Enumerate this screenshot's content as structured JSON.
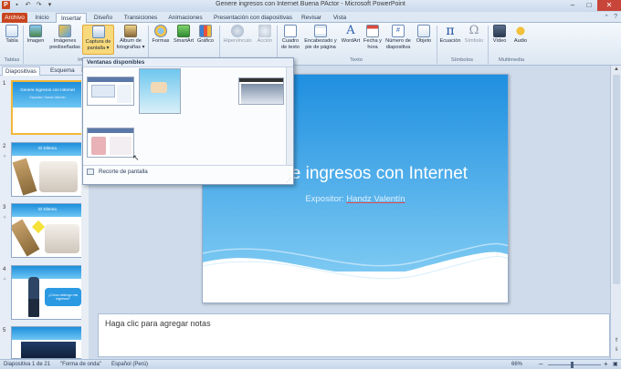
{
  "window": {
    "title": "Genere ingresos con Internet Buena PActor - Microsoft PowerPoint",
    "controls": [
      "–",
      "□",
      "✕"
    ]
  },
  "tabs": [
    "Archivo",
    "Inicio",
    "Insertar",
    "Diseño",
    "Transiciones",
    "Animaciones",
    "Presentación con diapositivas",
    "Revisar",
    "Vista"
  ],
  "ribbon": {
    "buttons": {
      "tabla": "Tabla",
      "imagen": "Imagen",
      "imagenes": "Imágenes prediseñadas",
      "captura": "Captura de pantalla ▾",
      "album": "Álbum de fotografías ▾",
      "formas": "Formas",
      "smartart": "SmartArt",
      "grafico": "Gráfico",
      "hipervinculo": "Hipervínculo",
      "accion": "Acción",
      "cuadro": "Cuadro de texto",
      "encabezado": "Encabezado y pie de página",
      "wordart": "WordArt",
      "fecha": "Fecha y hora",
      "numero": "Número de diapositiva",
      "objeto": "Objeto",
      "ecuacion": "Ecuación",
      "simbolo": "Símbolo",
      "video": "Vídeo",
      "audio": "Audio"
    },
    "groups": {
      "tablas": "Tablas",
      "imagenes": "Imá",
      "texto": "Texto",
      "simbolos": "Símbolos",
      "multimedia": "Multimedia"
    }
  },
  "leftpane": {
    "tabs": [
      "Diapositivas",
      "Esquema"
    ],
    "close": "✕",
    "slides": [
      {
        "num": "1",
        "title": "Genere ingresos con Internet",
        "sub": "Expositor: Handz Valentín"
      },
      {
        "num": "2",
        "title": "El Dilema",
        "sub": ""
      },
      {
        "num": "3",
        "title": "El Dilema",
        "sub": ""
      },
      {
        "num": "4",
        "title": "",
        "sub": "¿Cómo obtengo mis ingresos?"
      },
      {
        "num": "5",
        "title": "",
        "sub": ""
      }
    ]
  },
  "dropdown": {
    "header": "Ventanas disponibles",
    "item": "Recorte de pantalla"
  },
  "slide": {
    "title": "Genere ingresos con Internet",
    "subtitle_prefix": "Expositor: ",
    "subtitle_name": "Handz Valentín",
    "accent": "#2b97e3"
  },
  "notes": {
    "placeholder": "Haga clic para agregar notas"
  },
  "status": {
    "slide": "Diapositiva 1 de 21",
    "theme": "\"Forma de onda\"",
    "language": "Español (Perú)",
    "zoom": "66%"
  }
}
